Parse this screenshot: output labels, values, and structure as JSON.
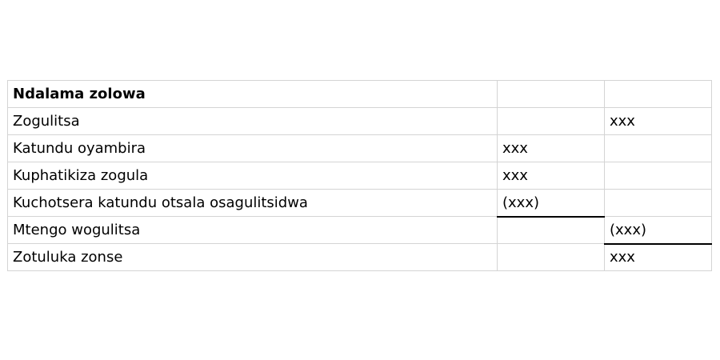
{
  "table": {
    "rows": [
      {
        "label": "Ndalama zolowa",
        "col1": "",
        "col2": ""
      },
      {
        "label": "Zogulitsa",
        "col1": "",
        "col2": "xxx"
      },
      {
        "label": "Katundu oyambira",
        "col1": "xxx",
        "col2": ""
      },
      {
        "label": "Kuphatikiza zogula",
        "col1": "xxx",
        "col2": ""
      },
      {
        "label": "Kuchotsera katundu otsala osagulitsidwa",
        "col1": "(xxx)",
        "col2": ""
      },
      {
        "label": "Mtengo wogulitsa",
        "col1": "",
        "col2": "(xxx)"
      },
      {
        "label": "Zotuluka zonse",
        "col1": "",
        "col2": "xxx"
      }
    ]
  }
}
